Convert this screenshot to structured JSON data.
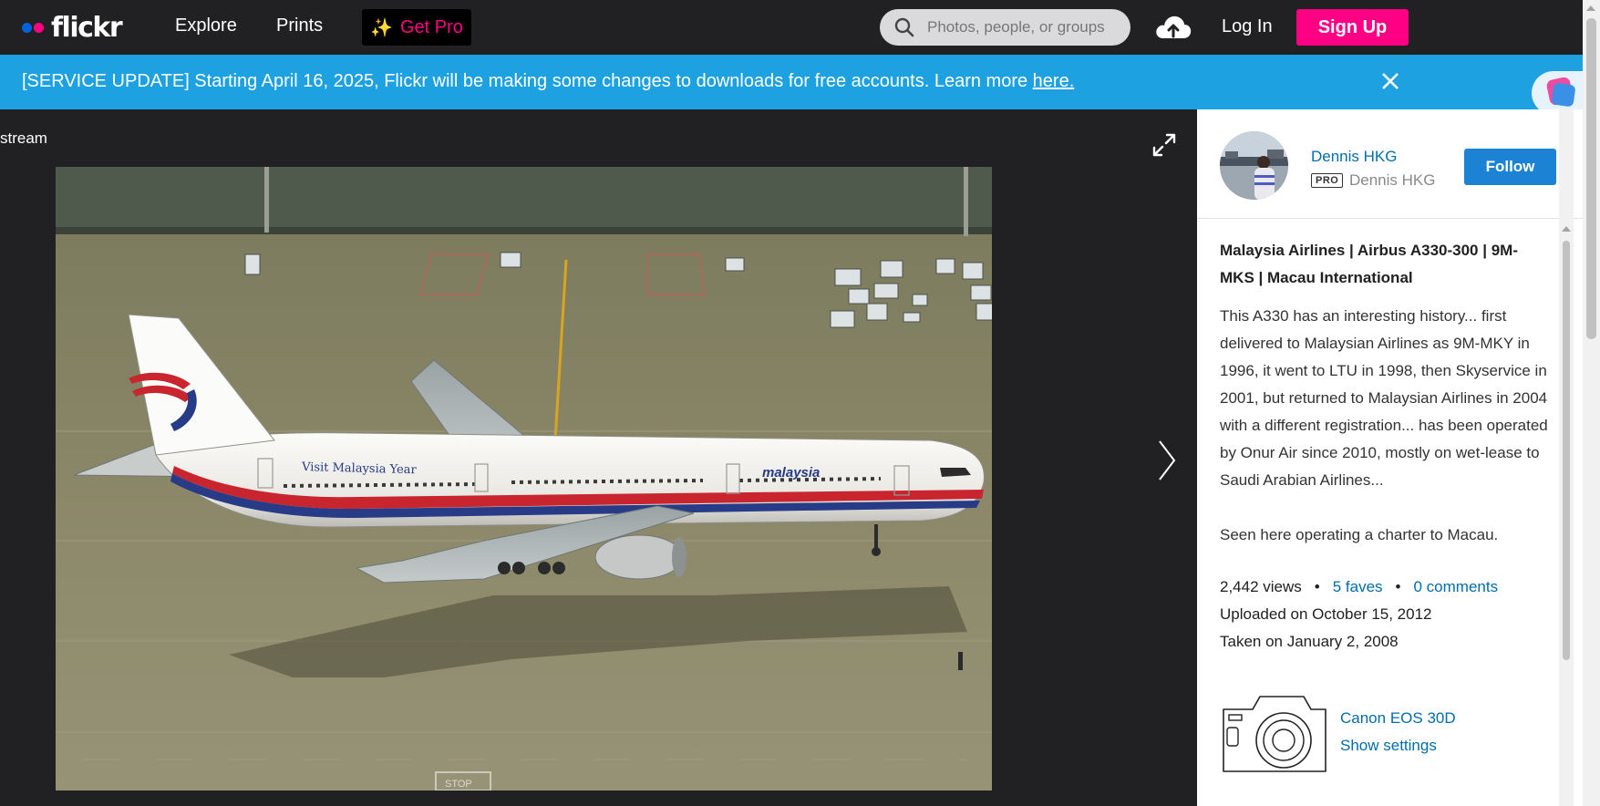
{
  "header": {
    "logo_text": "flickr",
    "nav": [
      {
        "label": "Explore"
      },
      {
        "label": "Prints"
      }
    ],
    "get_pro_label": "Get Pro",
    "search_placeholder": "Photos, people, or groups",
    "login_label": "Log In",
    "signup_label": "Sign Up"
  },
  "banner": {
    "text": "[SERVICE UPDATE] Starting April 16, 2025, Flickr will be making some changes to downloads for free accounts. Learn more ",
    "link_text": "here."
  },
  "photo_view": {
    "breadcrumb_text": "stream"
  },
  "owner": {
    "name": "Dennis HKG",
    "badge": "PRO",
    "alias": "Dennis HKG",
    "follow_label": "Follow"
  },
  "photo": {
    "title": "Malaysia Airlines | Airbus A330-300 | 9M-MKS | Macau International",
    "description": "This A330 has an interesting history... first delivered to Malaysian Airlines as 9M-MKY in 1996, it went to LTU in 1998, then Skyservice in 2001, but returned to Malaysian Airlines in 2004 with a different registration... has been operated by Onur Air since 2010, mostly on wet-lease to Saudi Arabian Airlines...",
    "description_2": "Seen here operating a charter to Macau.",
    "views": "2,442 views",
    "faves": "5 faves",
    "comments": "0 comments",
    "uploaded": "Uploaded on October 15, 2012",
    "taken": "Taken on January 2, 2008",
    "livery_text": "Visit Malaysia Year",
    "livery_brand": "malaysia",
    "ground_marking": "STOP"
  },
  "camera": {
    "name": "Canon EOS 30D",
    "settings_label": "Show settings"
  },
  "colors": {
    "nav_bg": "#212124",
    "brand_pink": "#ff0084",
    "brand_blue": "#0063dc",
    "banner_bg": "#1ea1e0",
    "link_blue": "#006dac",
    "follow_blue": "#1c82d4"
  }
}
